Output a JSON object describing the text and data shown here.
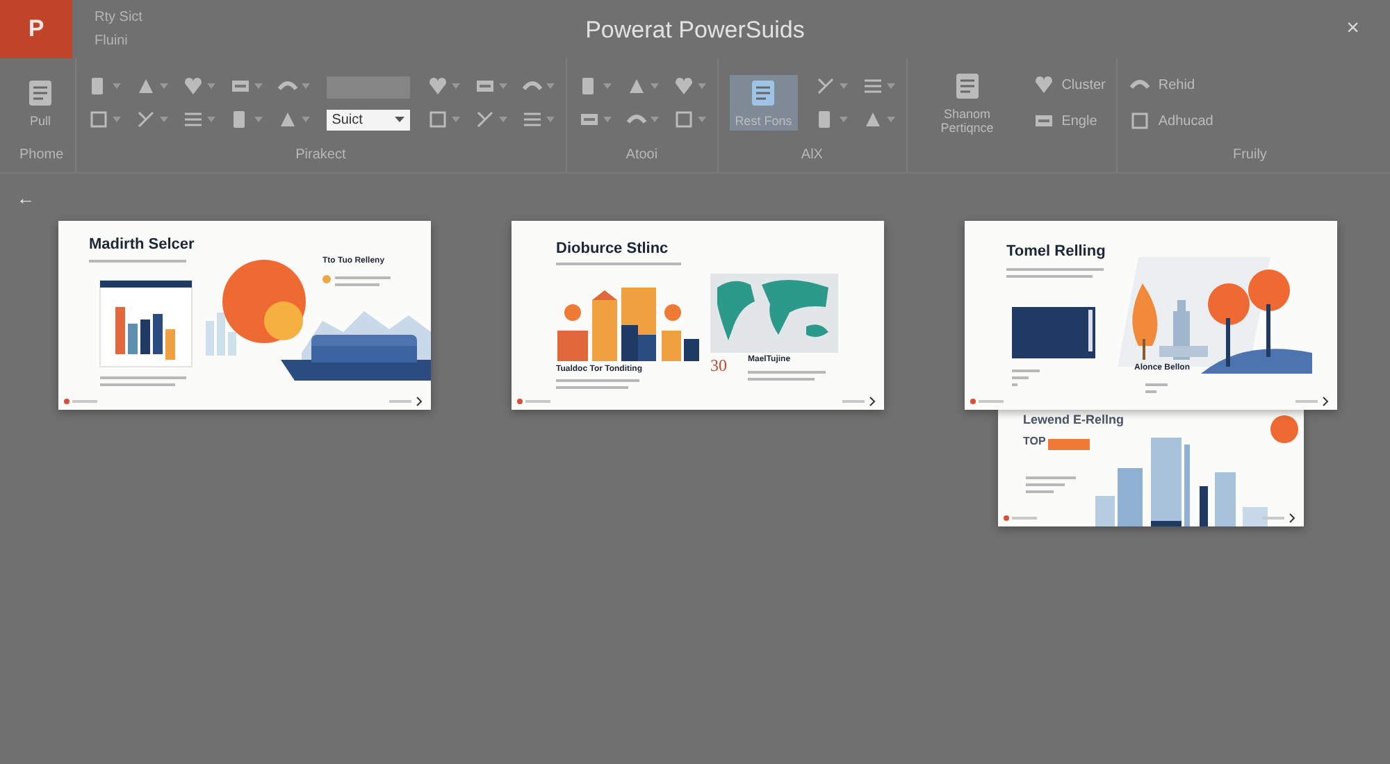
{
  "window": {
    "app_logo": "P",
    "title": "Powerat PowerSuids",
    "close": "×",
    "quick_lines": [
      "Rty Sict",
      "Fluini"
    ]
  },
  "ribbon": {
    "groups": [
      {
        "label": "Phome",
        "controls": [
          {
            "kind": "large",
            "label": "Pull"
          }
        ]
      },
      {
        "label": "Pirakect",
        "controls": [
          {
            "kind": "tools"
          },
          {
            "kind": "field",
            "value": "Suict"
          },
          {
            "kind": "tools"
          }
        ]
      },
      {
        "label": "Atooi",
        "controls": [
          {
            "kind": "tools"
          }
        ]
      },
      {
        "label": "AlX",
        "controls": [
          {
            "kind": "large",
            "label": "Rest Fons",
            "selected": true
          },
          {
            "kind": "tools"
          }
        ]
      },
      {
        "controls": [
          {
            "kind": "large",
            "label": "Shanom Pertiqnce",
            "selected": false
          },
          {
            "kind": "stack",
            "items": [
              "Cluster",
              "Engle"
            ]
          }
        ]
      },
      {
        "label": "Fruily",
        "controls": [
          {
            "kind": "stack",
            "items": [
              "Rehid",
              "Adhucad"
            ]
          }
        ]
      }
    ]
  },
  "back": "←",
  "slides": [
    {
      "kind": "chart-sofa",
      "title": "Madirth Selcer",
      "side_title": "Tto Tuo Relleny"
    },
    {
      "kind": "chart-map",
      "title": "Dioburce Stlinc",
      "caption": "Tualdoc Tor Tonditing",
      "figure": "30",
      "figure_title": "MaelTujine"
    },
    {
      "kind": "trees",
      "title": "Tomel Relling",
      "side_title": "Alonce Bellon"
    },
    {
      "kind": "city",
      "title": "Lewend E-Rellng",
      "badge": "TOP"
    }
  ]
}
